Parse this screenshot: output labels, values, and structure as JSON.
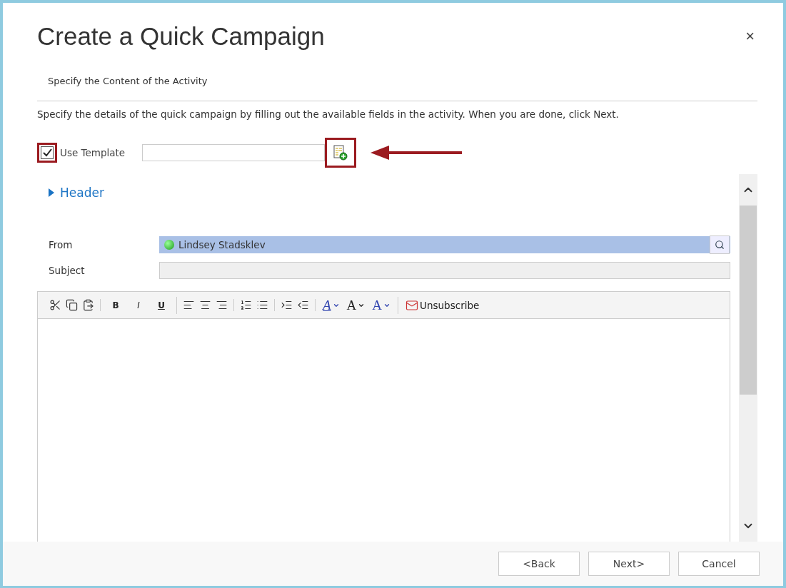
{
  "dialog": {
    "title": "Create a Quick Campaign",
    "close": "×",
    "subtitle": "Specify the Content of the Activity",
    "description": "Specify the details of the quick campaign by filling out the available fields in the activity. When you are done, click Next."
  },
  "template": {
    "label": "Use Template",
    "checked": true,
    "checkbox_highlighted": true,
    "lookup_highlighted": true,
    "arrow": true
  },
  "section": {
    "title": "Header",
    "expanded": false
  },
  "fields": [
    {
      "label": "From",
      "kind": "lookup",
      "value": "Lindsey Stadsklev",
      "selected": true
    },
    {
      "label": "Subject",
      "kind": "text",
      "disabled": true
    }
  ],
  "toolbar": [
    [
      {
        "kind": "cut"
      },
      {
        "kind": "copy"
      },
      {
        "kind": "paste"
      }
    ],
    [
      {
        "kind": "bold",
        "text": "B"
      },
      {
        "kind": "italic",
        "text": "I"
      },
      {
        "kind": "underline",
        "text": "U"
      }
    ],
    [
      {
        "kind": "align-left"
      },
      {
        "kind": "align-center"
      },
      {
        "kind": "align-right"
      }
    ],
    [
      {
        "kind": "numbered-list"
      },
      {
        "kind": "bullet-list"
      }
    ],
    [
      {
        "kind": "indent"
      },
      {
        "kind": "outdent"
      }
    ],
    [
      {
        "kind": "highlight",
        "text": "A"
      },
      {
        "kind": "font-size",
        "text": "A"
      },
      {
        "kind": "font-color",
        "text": "A"
      }
    ],
    [
      {
        "kind": "unsubscribe",
        "text": "Unsubscribe"
      }
    ]
  ],
  "buttons": [
    "<Back",
    "Next>",
    "Cancel"
  ]
}
